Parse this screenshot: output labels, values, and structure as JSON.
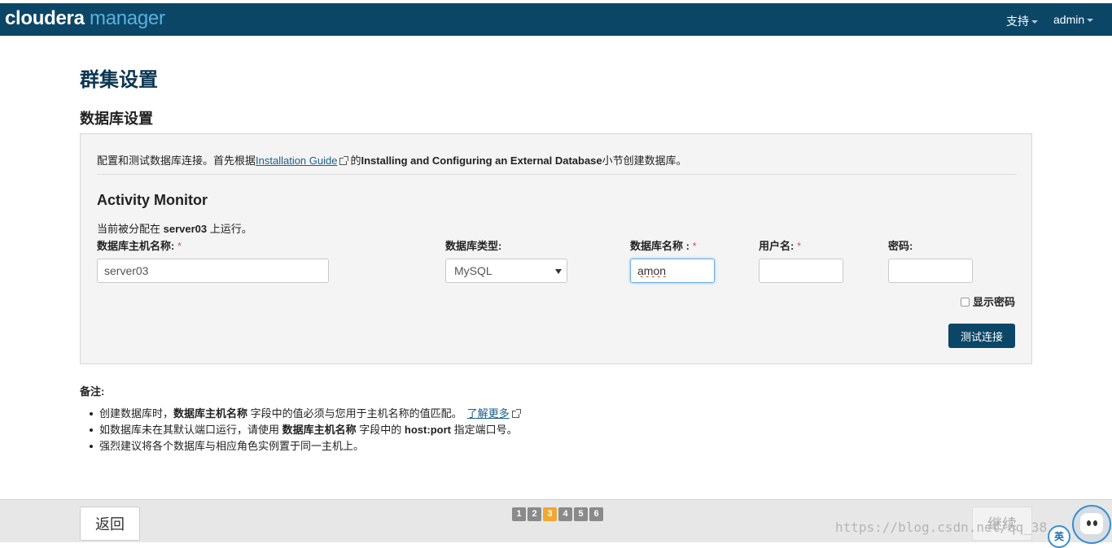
{
  "header": {
    "brand_part1": "cloudera",
    "brand_part2": "manager",
    "support": "支持",
    "user": "admin"
  },
  "page_title": "群集设置",
  "section_title": "数据库设置",
  "intro": {
    "prefix": "配置和测试数据库连接。首先根据",
    "link": "Installation Guide",
    "middle": "的",
    "bold": "Installing and Configuring an External Database",
    "suffix": "小节创建数据库。"
  },
  "role": {
    "title": "Activity Monitor",
    "assigned_prefix": "当前被分配在",
    "assigned_host": "server03",
    "assigned_suffix": "上运行。"
  },
  "fields": {
    "host_label": "数据库主机名称:",
    "host_value": "server03",
    "type_label": "数据库类型:",
    "type_value": "MySQL",
    "dbname_label": "数据库名称 :",
    "dbname_value": "amon",
    "username_label": "用户名:",
    "username_value": "",
    "password_label": "密码:",
    "password_value": "",
    "required_mark": "*"
  },
  "show_password": "显示密码",
  "test_button": "测试连接",
  "notes": {
    "title": "备注:",
    "n1_a": "创建数据库时，",
    "n1_b": "数据库主机名称",
    "n1_c": "字段中的值必须与您用于主机名称的值匹配。",
    "n1_link": "了解更多",
    "n2_a": "如数据库未在其默认端口运行，请使用",
    "n2_b": "数据库主机名称",
    "n2_c": "字段中的",
    "n2_d": "host:port",
    "n2_e": "指定端口号。",
    "n3": "强烈建议将各个数据库与相应角色实例置于同一主机上。"
  },
  "footer": {
    "back": "返回",
    "continue": "继续",
    "steps": [
      "1",
      "2",
      "3",
      "4",
      "5",
      "6"
    ],
    "active_step": 3
  },
  "watermark": "https://blog.csdn.net/qq_38",
  "ime": "英",
  "colors": {
    "nav_bg": "#0b4667",
    "brand_accent": "#5ab0dc",
    "step_active": "#f0a830",
    "required": "#d9534f"
  }
}
